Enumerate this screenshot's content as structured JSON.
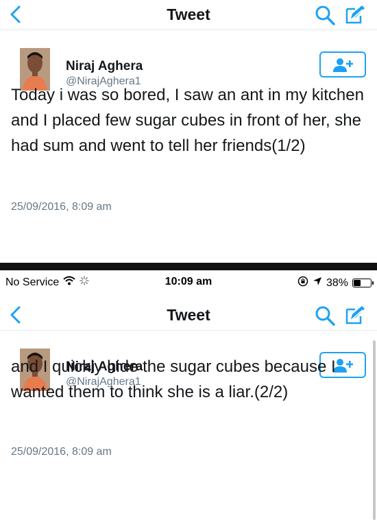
{
  "colors": {
    "accent": "#1da1f2",
    "text": "#14171a",
    "muted": "#657786",
    "divider": "#111111"
  },
  "status_bar": {
    "carrier": "No Service",
    "time": "10:09 am",
    "battery_percent": "38%",
    "battery_level": 0.38,
    "icons": [
      "wifi-icon",
      "loading-spinner-icon",
      "rotation-lock-icon",
      "location-arrow-icon",
      "battery-icon"
    ]
  },
  "screens": [
    {
      "nav": {
        "back_icon": "chevron-left-icon",
        "title": "Tweet",
        "search_icon": "search-icon",
        "compose_icon": "compose-icon"
      },
      "tweet": {
        "author_name": "Niraj Aghera",
        "author_handle": "@NirajAghera1",
        "follow_icon": "add-user-icon",
        "text": "Today i was so bored, I saw an ant in my kitchen and I placed few sugar cubes in front of her, she had sum and went to tell her friends(1/2)",
        "timestamp": "25/09/2016, 8:09 am"
      }
    },
    {
      "nav": {
        "back_icon": "chevron-left-icon",
        "title": "Tweet",
        "search_icon": "search-icon",
        "compose_icon": "compose-icon"
      },
      "tweet": {
        "author_name": "Niraj Aghera",
        "author_handle": "@NirajAghera1",
        "follow_icon": "add-user-icon",
        "text": "and I quickly hide the sugar cubes because I wanted them to think she is a liar.(2/2)",
        "timestamp": "25/09/2016, 8:09 am"
      }
    }
  ]
}
